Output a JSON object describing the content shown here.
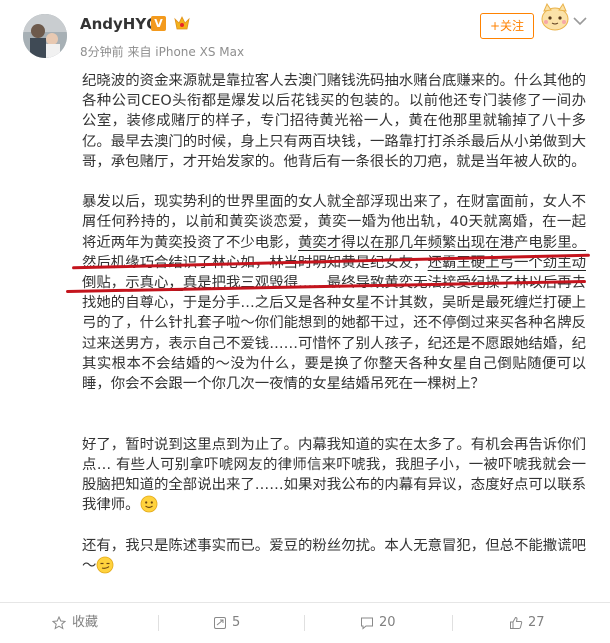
{
  "header": {
    "username": "AndyHYQ",
    "verified_badge": "V",
    "vip_icon": "crown-vip-icon",
    "time": "8分钟前",
    "source": "来自 iPhone XS Max",
    "follow_label": "+关注",
    "accent_color": "#ff8200",
    "badge_color": "#f39a1d"
  },
  "post": {
    "p1_a": "纪晓波的资金来源就是靠拉客人去澳门赌钱洗码抽水赌台底赚来的。什么其他的各种公司CEO头衔都是爆发以后花钱买的包装的。以前他还专门装修了一间办公室，装修成赌厅的样子，专门招待黄光裕一人，黄在他那里就输掉了八十多亿。最早去澳门的时候，身上只有两百块钱，一路靠打打杀杀最后从小弟做到大哥，承包赌厅，才开始发家的。他背后有一条很长的刀疤，就是当年被人砍的。",
    "p2_a": "暴发以后，现实势利的世界里面的女人就全部浮现出来了，在财富面前，女人不屑任何矜持的，以前和黄奕谈恋爱，黄奕一婚为他出轨，40天就离婚，在一起将近两年为黄奕投资了不少电影，",
    "p2_u1": "黄奕才得以在那几年频繁出现在港产电影里。",
    "p2_b": "然后机缘巧合结识了林心如，林当时明知黄是纪女友，",
    "p2_u2": "还霸王硬上弓一个劲主动倒贴，示真心，",
    "p2_c": "真是把我三观毁得……最终导致黄奕无法接受纪操了林以后再去找她的自尊心，于是分手…之后又是各种女星不计其数，吴昕是最死缠烂打硬上弓的了，什么针扎套子啦～你们能想到的她都干过，还不停倒过来买各种名牌反过来送男方，表示自己不爱钱……可惜怀了别人孩子，纪还是不愿跟她结婚，纪其实根本不会结婚的～没为什么，要是换了你整天各种女星自己倒贴随便可以睡，你会不会跟一个你几次一夜情的女星结婚吊死在一棵树上？",
    "p3": "好了，暂时说到这里点到为止了。内幕我知道的实在太多了。有机会再告诉你们点… 有些人可别拿吓唬网友的律师信来吓唬我，我胆子小，一被吓唬我就会一股脑把知道的全部说出来了……如果对我公布的内幕有异议，态度好点可以联系我律师。",
    "p4": "还有，我只是陈述事实而已。爱豆的粉丝勿扰。本人无意冒犯，但总不能撒谎吧～",
    "smile_icon": "smile-emoji-icon",
    "annotation_color": "#c4141d"
  },
  "toolbar": {
    "favorite_label": "收藏",
    "repost_count": "5",
    "comment_count": "20",
    "like_count": "27"
  }
}
